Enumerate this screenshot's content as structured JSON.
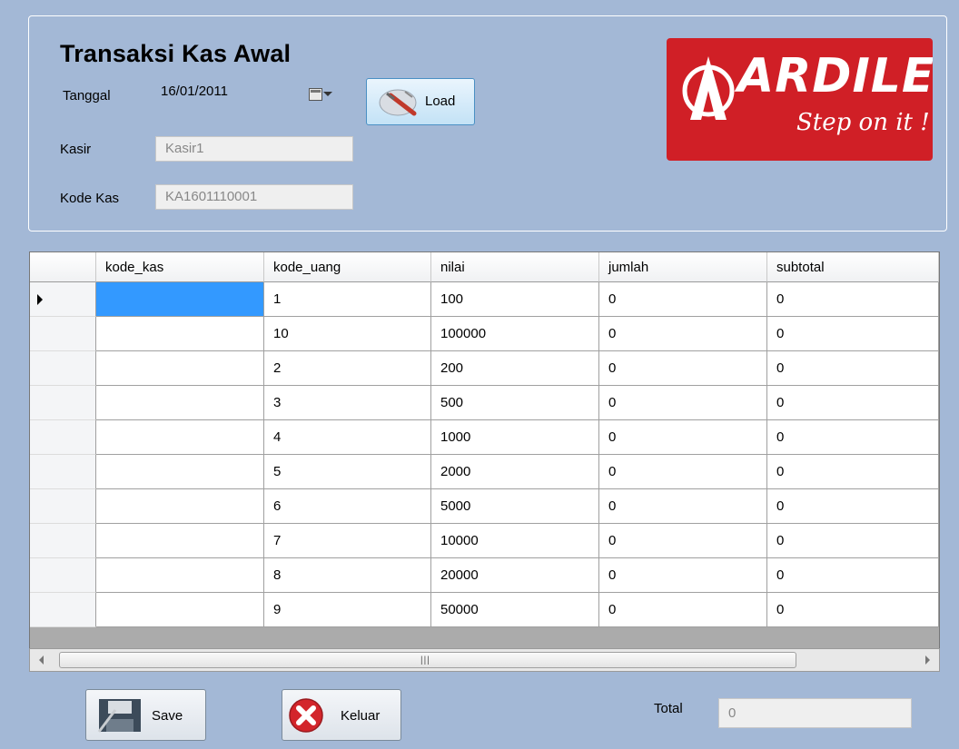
{
  "form": {
    "title": "Transaksi Kas Awal",
    "tanggal_label": "Tanggal",
    "tanggal_value": "16/01/2011",
    "kasir_label": "Kasir",
    "kasir_value": "Kasir1",
    "kode_kas_label": "Kode Kas",
    "kode_kas_value": "KA1601110001",
    "load_label": "Load"
  },
  "logo": {
    "brand_text": "ARDILES",
    "slogan_text": "Step on it !",
    "color": "#d01f26"
  },
  "grid": {
    "columns": [
      "kode_kas",
      "kode_uang",
      "nilai",
      "jumlah",
      "subtotal"
    ],
    "rows": [
      [
        "",
        "1",
        "100",
        "0",
        "0"
      ],
      [
        "",
        "10",
        "100000",
        "0",
        "0"
      ],
      [
        "",
        "2",
        "200",
        "0",
        "0"
      ],
      [
        "",
        "3",
        "500",
        "0",
        "0"
      ],
      [
        "",
        "4",
        "1000",
        "0",
        "0"
      ],
      [
        "",
        "5",
        "2000",
        "0",
        "0"
      ],
      [
        "",
        "6",
        "5000",
        "0",
        "0"
      ],
      [
        "",
        "7",
        "10000",
        "0",
        "0"
      ],
      [
        "",
        "8",
        "20000",
        "0",
        "0"
      ],
      [
        "",
        "9",
        "50000",
        "0",
        "0"
      ]
    ],
    "selected_row": 0
  },
  "footer": {
    "save_label": "Save",
    "keluar_label": "Keluar",
    "total_label": "Total",
    "total_value": "0"
  },
  "colors": {
    "background": "#a3b8d6",
    "selection": "#3399ff"
  }
}
